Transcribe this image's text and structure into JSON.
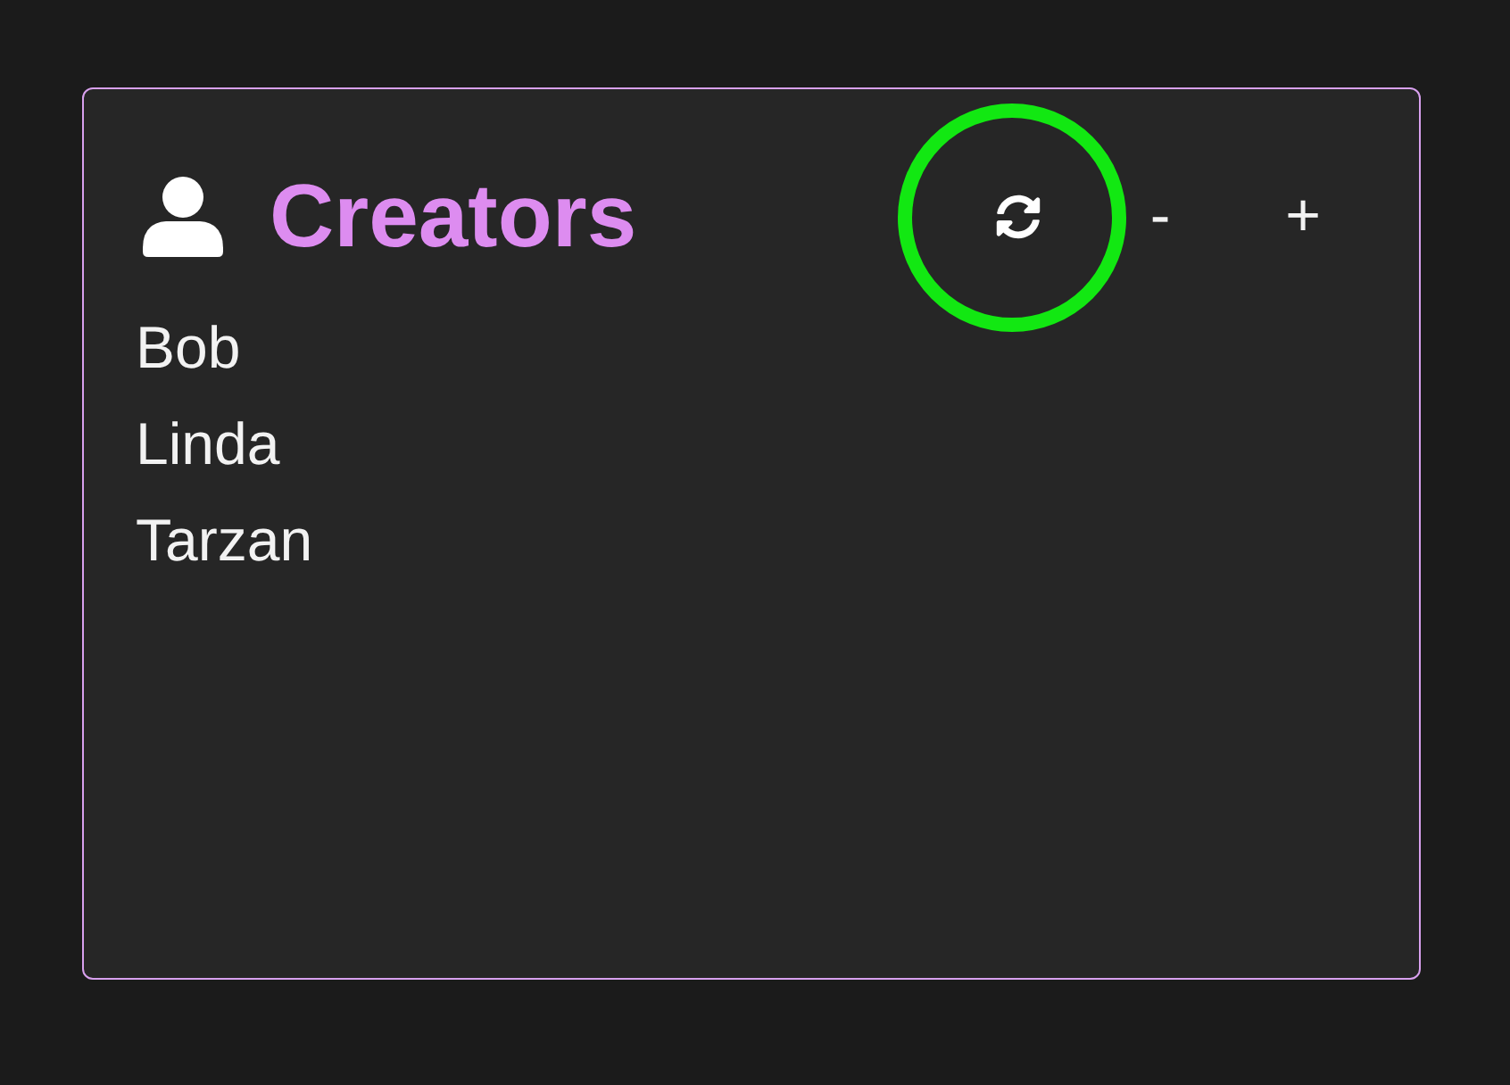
{
  "panel": {
    "title": "Creators",
    "header_buttons": [
      {
        "kind": "refresh",
        "highlighted": true
      },
      {
        "kind": "text",
        "label": "-",
        "highlighted": false
      },
      {
        "kind": "text",
        "label": "+",
        "highlighted": false
      }
    ],
    "items": [
      "Bob",
      "Linda",
      "Tarzan"
    ]
  }
}
